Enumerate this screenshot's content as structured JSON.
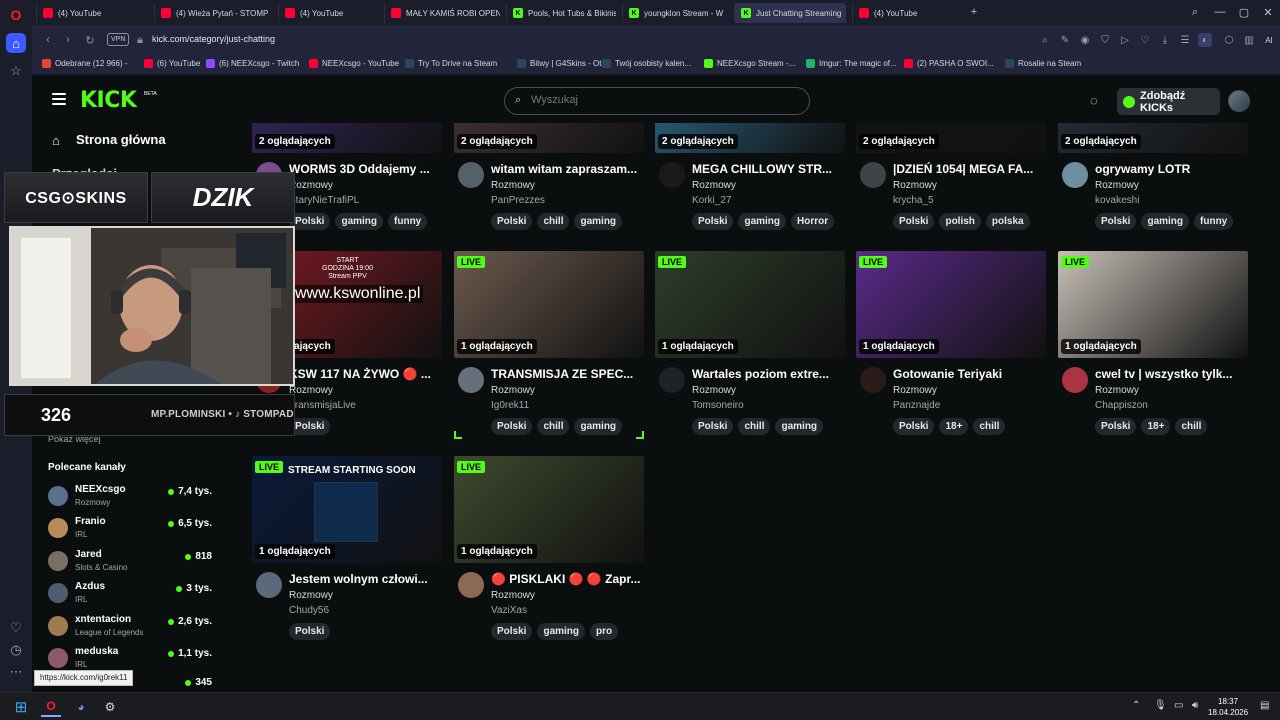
{
  "browser": {
    "tabs": [
      {
        "label": "(4) YouTube",
        "fav": "yt"
      },
      {
        "label": "(4) Wieża Pytań - STOMP",
        "fav": "yt"
      },
      {
        "label": "(4) YouTube",
        "fav": "yt"
      },
      {
        "label": "MAŁY KAMIŚ ROBI OPEN",
        "fav": "yt"
      },
      {
        "label": "Pools, Hot Tubs & Bikinis",
        "fav": "kick"
      },
      {
        "label": "youngklon Stream - W",
        "fav": "kick"
      },
      {
        "label": "Just Chatting Streaming",
        "fav": "kick",
        "active": true
      },
      {
        "label": "(4) YouTube",
        "fav": "yt"
      }
    ],
    "vpn_label": "VPN",
    "url": "kick.com/category/just-chatting",
    "bookmarks": [
      {
        "label": "Odebrane (12 966) -",
        "fav": "gmail"
      },
      {
        "label": "(6) YouTube",
        "fav": "yt"
      },
      {
        "label": "(6) NEEXcsgo - Twitch",
        "fav": "twitch"
      },
      {
        "label": "NEEXcsgo - YouTube",
        "fav": "yt"
      },
      {
        "label": "Try To Drive na Steam",
        "fav": "steam"
      },
      {
        "label": "Bitwy | G4Skins - Ot...",
        "fav": "steam"
      },
      {
        "label": "Twój osobisty kalen...",
        "fav": "steam"
      },
      {
        "label": "NEEXcsgo Stream -...",
        "fav": "kick"
      },
      {
        "label": "Imgur: The magic of...",
        "fav": "imgur"
      },
      {
        "label": "(2) PASHA O SWOI...",
        "fav": "yt"
      },
      {
        "label": "Rosalie na Steam",
        "fav": "steam"
      }
    ],
    "hover_url": "https://kick.com/ig0rek11",
    "ai_label": "AI"
  },
  "kick": {
    "logo": "KICK",
    "beta": "BETA",
    "search_placeholder": "Wyszukaj",
    "kicks_button": "Zdobądź KICKs",
    "sidebar": {
      "home": "Strona główna",
      "browse": "Przeglądaj",
      "show_more": "Pokaż więcej",
      "recommended_title": "Polecane kanały",
      "channels": [
        {
          "name": "NEEXcsgo",
          "category": "Rozmowy",
          "viewers": "7,4 tys.",
          "color": "#5a6f8c"
        },
        {
          "name": "Franio",
          "category": "IRL",
          "viewers": "6,5 tys.",
          "color": "#b88a5c"
        },
        {
          "name": "Jared",
          "category": "Slots & Casino",
          "viewers": "818",
          "color": "#7b6f63"
        },
        {
          "name": "Azdus",
          "category": "IRL",
          "viewers": "3 tys.",
          "color": "#4f5d70"
        },
        {
          "name": "xntentacion",
          "category": "League of Legends",
          "viewers": "2,6 tys.",
          "color": "#9c7a52"
        },
        {
          "name": "meduska",
          "category": "IRL",
          "viewers": "1,1 tys.",
          "color": "#8a5a6a"
        },
        {
          "name": "",
          "category": "",
          "viewers": "345",
          "color": "#555"
        }
      ]
    },
    "cards": [
      {
        "title": "WORMS 3D Oddajemy ...",
        "category": "Rozmowy",
        "user": "StaryNieTrafiPL",
        "viewers": "2 oglądających",
        "tags": [
          "Polski",
          "gaming",
          "funny"
        ],
        "live": false,
        "row": 0,
        "avatar": "#7a4e8a",
        "thumb": "#3a2a6a"
      },
      {
        "title": "witam witam zapraszam...",
        "category": "Rozmowy",
        "user": "PanPrezzes",
        "viewers": "2 oglądających",
        "tags": [
          "Polski",
          "chill",
          "gaming"
        ],
        "live": false,
        "row": 0,
        "avatar": "#55606a",
        "thumb": "#4a3a3a"
      },
      {
        "title": "MEGA CHILLOWY STR...",
        "category": "Rozmowy",
        "user": "Korki_27",
        "viewers": "2 oglądających",
        "tags": [
          "Polski",
          "gaming",
          "Horror"
        ],
        "live": false,
        "row": 0,
        "avatar": "#1a1a1a",
        "thumb": "#2f6f8f"
      },
      {
        "title": "|DZIEŃ 1054| MEGA FA...",
        "category": "Rozmowy",
        "user": "krycha_5",
        "viewers": "2 oglądających",
        "tags": [
          "Polski",
          "polish",
          "polska"
        ],
        "live": false,
        "row": 0,
        "avatar": "#3f4448",
        "thumb": "#111418"
      },
      {
        "title": "ogrywamy LOTR",
        "category": "Rozmowy",
        "user": "kovakeshi",
        "viewers": "2 oglądających",
        "tags": [
          "Polski",
          "gaming",
          "funny"
        ],
        "live": false,
        "row": 0,
        "avatar": "#6f8fa0",
        "thumb": "#2a3340"
      },
      {
        "title": "KSW 117 NA ŻYWO 🔴 ...",
        "category": "Rozmowy",
        "user": "TransmisjaLive",
        "viewers": "1 oglądających",
        "tags": [
          "Polski"
        ],
        "live": false,
        "row": 1,
        "avatar": "#882222",
        "thumb": "#7a1a22"
      },
      {
        "title": "TRANSMISJA ZE SPEC...",
        "category": "Rozmowy",
        "user": "Ig0rek11",
        "viewers": "1 oglądających",
        "tags": [
          "Polski",
          "chill",
          "gaming"
        ],
        "live": true,
        "row": 1,
        "avatar": "#66707a",
        "thumb": "#6b5a4e"
      },
      {
        "title": "Wartales poziom extre...",
        "category": "Rozmowy",
        "user": "Tomsoneiro",
        "viewers": "1 oglądających",
        "tags": [
          "Polski",
          "chill",
          "gaming"
        ],
        "live": true,
        "row": 1,
        "avatar": "#1e2226",
        "thumb": "#2e3d2a"
      },
      {
        "title": "Gotowanie Teriyaki",
        "category": "Rozmowy",
        "user": "Panznajde",
        "viewers": "1 oglądających",
        "tags": [
          "Polski",
          "18+",
          "chill"
        ],
        "live": true,
        "row": 1,
        "avatar": "#2a1a1a",
        "thumb": "#5a2a8a"
      },
      {
        "title": "cwel tv | wszystko tylk...",
        "category": "Rozmowy",
        "user": "Chappiszon",
        "viewers": "1 oglądających",
        "tags": [
          "Polski",
          "18+",
          "chill"
        ],
        "live": true,
        "row": 1,
        "avatar": "#aa3344",
        "thumb": "#c8c0b8"
      },
      {
        "title": "Jestem wolnym człowi...",
        "category": "Rozmowy",
        "user": "Chudy56",
        "viewers": "1 oglądających",
        "tags": [
          "Polski"
        ],
        "live": true,
        "row": 2,
        "avatar": "#5a6a7a",
        "thumb": "#0a1a3a"
      },
      {
        "title": "🔴 PISKLAKI 🔴 🔴 Zapr...",
        "category": "Rozmowy",
        "user": "VaziXas",
        "viewers": "1 oglądających",
        "tags": [
          "Polski",
          "gaming",
          "pro"
        ],
        "live": true,
        "row": 2,
        "avatar": "#8a6a55",
        "thumb": "#3e4a2e"
      }
    ],
    "thumb_text": {
      "ksw_top": "START\nGODZINA 19:00\nStream PPV",
      "ksw_url": "www.kswonline.pl",
      "starting_soon": "STREAM STARTING SOON"
    },
    "live_label": "LIVE"
  },
  "overlay": {
    "sponsor1": "CSG⊙SKINS",
    "sponsor2": "DZIK",
    "count": "326",
    "ticker": "MP.PLOMINSKI • ♪ STOMPAD"
  },
  "taskbar": {
    "time": "18:37",
    "date": "18.04.2026"
  }
}
